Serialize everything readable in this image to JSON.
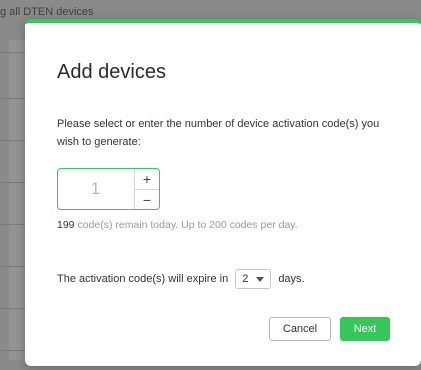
{
  "background": {
    "heading": "g all DTEN devices"
  },
  "modal": {
    "title": "Add devices",
    "instruction": "Please select or enter the number of device activation code(s) you wish to generate:",
    "stepper": {
      "value": "1",
      "plus": "+",
      "minus": "−"
    },
    "remaining": {
      "count": "199",
      "text": " code(s) remain today. Up to 200 codes per day."
    },
    "expiry": {
      "prefix": "The activation code(s) will expire in",
      "days_value": "2",
      "suffix": "days."
    },
    "buttons": {
      "cancel": "Cancel",
      "next": "Next"
    },
    "accent_color": "#35c759"
  }
}
